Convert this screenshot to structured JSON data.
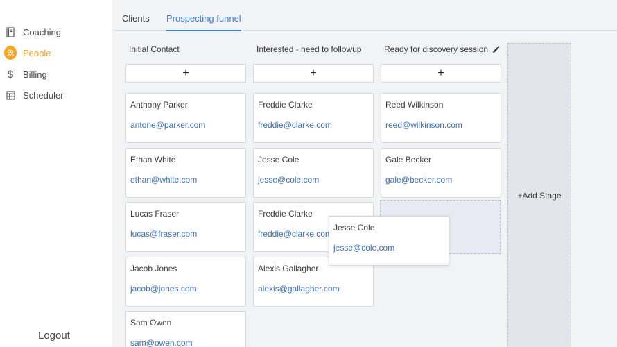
{
  "sidebar": {
    "items": [
      {
        "label": "Coaching",
        "icon": "notebook-icon",
        "active": false
      },
      {
        "label": "People",
        "icon": "people-icon",
        "active": true
      },
      {
        "label": "Billing",
        "icon": "dollar-icon",
        "active": false
      },
      {
        "label": "Scheduler",
        "icon": "calendar-icon",
        "active": false
      }
    ],
    "logout_label": "Logout"
  },
  "tabs": [
    {
      "label": "Clients",
      "active": false
    },
    {
      "label": "Prospecting funnel",
      "active": true
    }
  ],
  "columns": [
    {
      "title": "Initial Contact",
      "add_label": "+",
      "cards": [
        {
          "name": "Anthony Parker",
          "email": "antone@parker.com"
        },
        {
          "name": "Ethan White",
          "email": "ethan@white.com"
        },
        {
          "name": "Lucas Fraser",
          "email": "lucas@fraser.com"
        },
        {
          "name": "Jacob Jones",
          "email": "jacob@jones.com"
        },
        {
          "name": "Sam Owen",
          "email": "sam@owen.com"
        }
      ]
    },
    {
      "title": "Interested - need to followup",
      "add_label": "+",
      "cards": [
        {
          "name": "Freddie Clarke",
          "email": "freddie@clarke.com"
        },
        {
          "name": "Jesse Cole",
          "email": "jesse@cole.com"
        },
        {
          "name": "Freddie Clarke",
          "email": "freddie@clarke.com"
        },
        {
          "name": "Alexis Gallagher",
          "email": "alexis@gallagher.com"
        }
      ]
    },
    {
      "title": "Ready for discovery session",
      "add_label": "+",
      "edit_icon": "pencil-icon",
      "cards": [
        {
          "name": "Reed Wilkinson",
          "email": "reed@wilkinson.com"
        },
        {
          "name": "Gale Becker",
          "email": "gale@becker.com"
        }
      ]
    }
  ],
  "dragging_card": {
    "name": "Jesse Cole",
    "email": "jesse@cole,com"
  },
  "add_stage_label": "+Add Stage",
  "colors": {
    "accent": "#3b7dd8",
    "active_nav": "#f0a020",
    "email_link": "#3b6fb6"
  }
}
